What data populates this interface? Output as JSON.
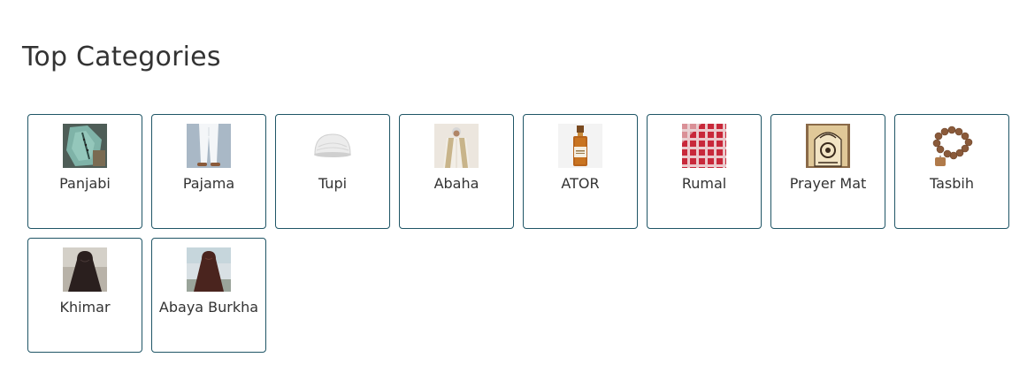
{
  "section": {
    "title": "Top Categories"
  },
  "categories": [
    {
      "label": "Panjabi",
      "icon": "panjabi-image"
    },
    {
      "label": "Pajama",
      "icon": "pajama-image"
    },
    {
      "label": "Tupi",
      "icon": "tupi-cap-image"
    },
    {
      "label": "Abaha",
      "icon": "abaha-image"
    },
    {
      "label": "ATOR",
      "icon": "ator-perfume-image"
    },
    {
      "label": "Rumal",
      "icon": "rumal-scarf-image"
    },
    {
      "label": "Prayer Mat",
      "icon": "prayer-mat-image"
    },
    {
      "label": "Tasbih",
      "icon": "tasbih-beads-image"
    },
    {
      "label": "Khimar",
      "icon": "khimar-image"
    },
    {
      "label": "Abaya Burkha",
      "icon": "abaya-burkha-image"
    }
  ],
  "colors": {
    "card_border": "#1f5566",
    "text": "#333333"
  }
}
